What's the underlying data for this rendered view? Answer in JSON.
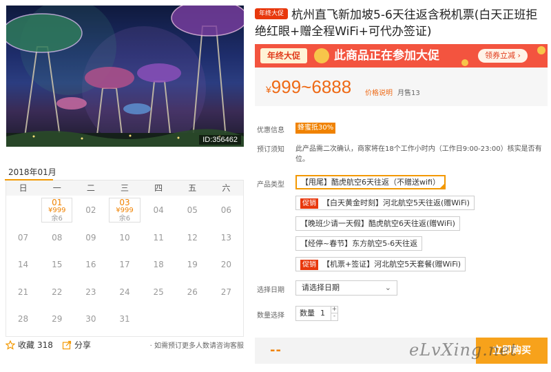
{
  "image": {
    "id": "ID:356462"
  },
  "calendar": {
    "month": "2018年01月",
    "weekdays": [
      "日",
      "一",
      "二",
      "三",
      "四",
      "五",
      "六"
    ],
    "cells": [
      {
        "day": "",
        "avail": false
      },
      {
        "day": "01",
        "avail": true,
        "price": "¥999",
        "remain": "余6"
      },
      {
        "day": "02",
        "avail": false
      },
      {
        "day": "03",
        "avail": true,
        "price": "¥999",
        "remain": "余6"
      },
      {
        "day": "04",
        "avail": false
      },
      {
        "day": "05",
        "avail": false
      },
      {
        "day": "06",
        "avail": false
      },
      {
        "day": "07",
        "avail": false
      },
      {
        "day": "08",
        "avail": false
      },
      {
        "day": "09",
        "avail": false
      },
      {
        "day": "10",
        "avail": false
      },
      {
        "day": "11",
        "avail": false
      },
      {
        "day": "12",
        "avail": false
      },
      {
        "day": "13",
        "avail": false
      },
      {
        "day": "14",
        "avail": false
      },
      {
        "day": "15",
        "avail": false
      },
      {
        "day": "16",
        "avail": false
      },
      {
        "day": "17",
        "avail": false
      },
      {
        "day": "18",
        "avail": false
      },
      {
        "day": "19",
        "avail": false
      },
      {
        "day": "20",
        "avail": false
      },
      {
        "day": "21",
        "avail": false
      },
      {
        "day": "22",
        "avail": false
      },
      {
        "day": "23",
        "avail": false
      },
      {
        "day": "24",
        "avail": false
      },
      {
        "day": "25",
        "avail": false
      },
      {
        "day": "26",
        "avail": false
      },
      {
        "day": "27",
        "avail": false
      },
      {
        "day": "28",
        "avail": false
      },
      {
        "day": "29",
        "avail": false
      },
      {
        "day": "30",
        "avail": false
      },
      {
        "day": "31",
        "avail": false
      }
    ]
  },
  "actions": {
    "favorite_label": "收藏",
    "favorite_count": "318",
    "share_label": "分享",
    "note": "· 如需预订更多人数请咨询客服"
  },
  "product": {
    "badge": "年终大促",
    "title": "杭州直飞新加坡5-6天往返含税机票(白天正班拒绝红眼+赠全程WiFi+可代办签证)"
  },
  "banner": {
    "tag": "年终大促",
    "text": "此商品正在参加大促",
    "coupon": "领券立减 ›"
  },
  "price": {
    "currency": "¥",
    "range": "999~6888",
    "link": "价格说明",
    "sold": "月售13"
  },
  "info": {
    "discount_label": "优惠信息",
    "discount_tag": "蜂蜜抵30%",
    "notice_label": "预订须知",
    "notice_text": "此产品需二次确认，商家将在18个工作小时内（工作日9:00-23:00）核实是否有位。"
  },
  "options": {
    "label": "产品类型",
    "items": [
      {
        "text": "【甩尾】酷虎航空6天往返（不赠送wifi）",
        "promo": "",
        "selected": true
      },
      {
        "text": "【白天黄金时刻】河北航空5天往返(赠WiFi)",
        "promo": "促销",
        "selected": false
      },
      {
        "text": "【晚班少请一天假】酷虎航空6天往返(赠WiFi)",
        "promo": "",
        "selected": false
      },
      {
        "text": "【经停~春节】东方航空5-6天往返",
        "promo": "",
        "selected": false
      },
      {
        "text": "【机票+签证】河北航空5天套餐(赠WiFi)",
        "promo": "促销",
        "selected": false
      }
    ]
  },
  "date_select": {
    "label": "选择日期",
    "value": "请选择日期"
  },
  "quantity": {
    "label": "数量选择",
    "prefix": "数量",
    "value": "1",
    "plus": "+",
    "minus": "-"
  },
  "buy": {
    "total": "--",
    "button": "立即购买"
  },
  "watermark": "eLvXing.net",
  "colors": {
    "accent": "#f08200",
    "promo": "#e8380d",
    "banner": "#f3543f",
    "buy": "#f7a21b"
  }
}
